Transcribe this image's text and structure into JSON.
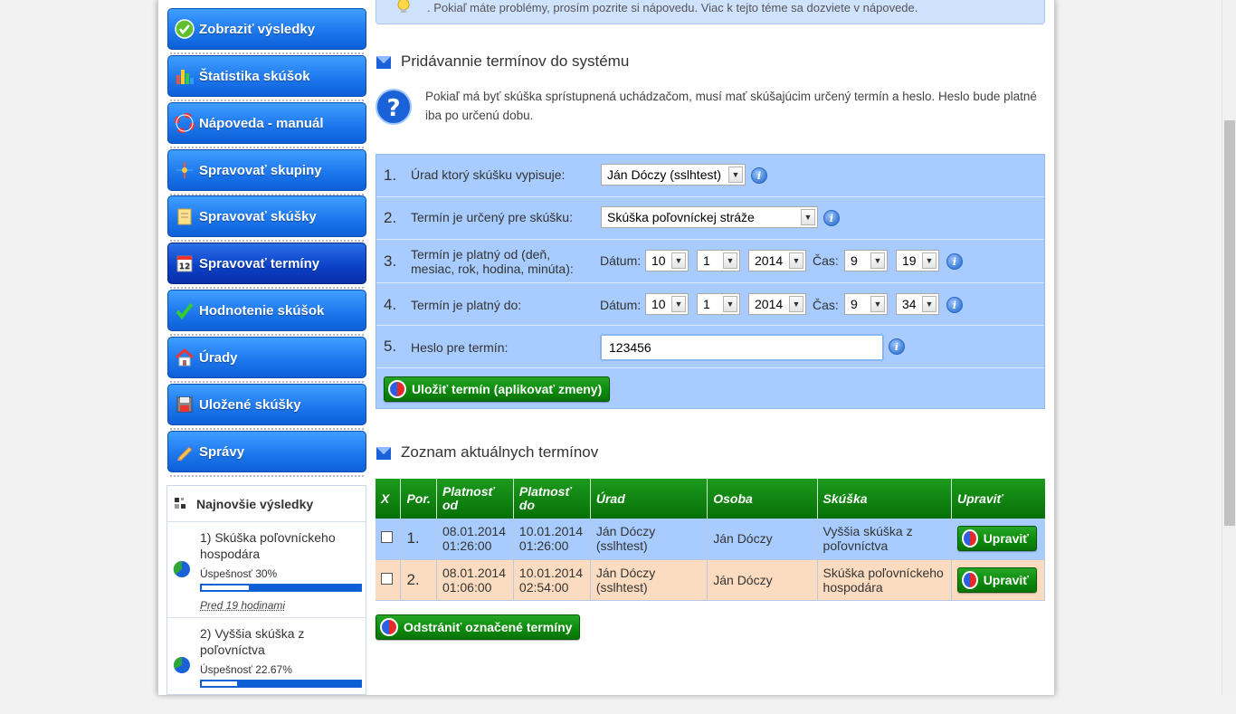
{
  "top_note": ". Pokiaľ máte problémy, prosím pozrite si nápovedu. Viac k tejto téme sa dozviete v nápovede.",
  "menu": [
    {
      "label": "Zobraziť výsledky",
      "icon": "check-circle-icon"
    },
    {
      "label": "Štatistika skúšok",
      "icon": "bar-chart-icon"
    },
    {
      "label": "Nápoveda - manuál",
      "icon": "lifebuoy-icon"
    },
    {
      "label": "Spravovať skupiny",
      "icon": "network-icon"
    },
    {
      "label": "Spravovať skúšky",
      "icon": "notepad-icon"
    },
    {
      "label": "Spravovať termíny",
      "icon": "calendar-icon",
      "active": true
    },
    {
      "label": "Hodnotenie skúšok",
      "icon": "checkmark-icon"
    },
    {
      "label": "Úrady",
      "icon": "house-icon"
    },
    {
      "label": "Uložené skúšky",
      "icon": "floppy-disk-icon"
    },
    {
      "label": "Správy",
      "icon": "pencil-icon"
    }
  ],
  "newest": {
    "title": "Najnovšie výsledky",
    "items": [
      {
        "title": "1) Skúška poľovníckeho hospodára",
        "success": "Úspešnosť 30%",
        "percent": 30,
        "when": "Pred 19 hodinami"
      },
      {
        "title": "2) Vyššia skúška z poľovníctva",
        "success": "Úspešnosť 22.67%",
        "percent": 22.67,
        "when": ""
      }
    ]
  },
  "add_section": {
    "title": "Pridávannie termínov do systému",
    "help": "Pokiaľ má byť skúška sprístupnená uchádzačom, musí mať skúšajúcim určený termín a heslo. Heslo bude platné iba po určenú dobu."
  },
  "form": {
    "rows": [
      {
        "num": "1.",
        "label": "Úrad ktorý skúšku vypisuje:",
        "value": "Ján Dóczy (sslhtest)"
      },
      {
        "num": "2.",
        "label": "Termín je určený pre skúšku:",
        "value": "Skúška poľovníckej stráže"
      },
      {
        "num": "3.",
        "label": "Termín je platný od (deň, mesiac, rok, hodina, minúta):",
        "date_label": "Dátum:",
        "time_label": "Čas:",
        "day": "10",
        "month": "1",
        "year": "2014",
        "hour": "9",
        "minute": "19"
      },
      {
        "num": "4.",
        "label": "Termín je platný do:",
        "date_label": "Dátum:",
        "time_label": "Čas:",
        "day": "10",
        "month": "1",
        "year": "2014",
        "hour": "9",
        "minute": "34"
      },
      {
        "num": "5.",
        "label": "Heslo pre termín:",
        "value": "123456"
      }
    ],
    "save_label": "Uložiť termín (aplikovať zmeny)"
  },
  "list_section": {
    "title": "Zoznam aktuálnych termínov",
    "headers": [
      "X",
      "Por.",
      "Platnosť od",
      "Platnosť do",
      "Úrad",
      "Osoba",
      "Skúška",
      "Upraviť"
    ],
    "rows": [
      {
        "por": "1.",
        "from": "08.01.2014 01:26:00",
        "to": "10.01.2014 01:26:00",
        "office": "Ján Dóczy (sslhtest)",
        "person": "Ján Dóczy",
        "exam": "Vyššia skúška z poľovníctva",
        "edit": "Upraviť"
      },
      {
        "por": "2.",
        "from": "08.01.2014 01:06:00",
        "to": "10.01.2014 02:54:00",
        "office": "Ján Dóczy (sslhtest)",
        "person": "Ján Dóczy",
        "exam": "Skúška poľovníckeho hospodára",
        "edit": "Upraviť"
      }
    ],
    "delete_label": "Odstrániť označené termíny"
  },
  "colors": {
    "menu_blue": "#1e78ee",
    "menu_active": "#0b3fc5",
    "green": "#0d8b0d",
    "form_bg": "#a8ccff",
    "row_alt": "#fcdcc0"
  }
}
